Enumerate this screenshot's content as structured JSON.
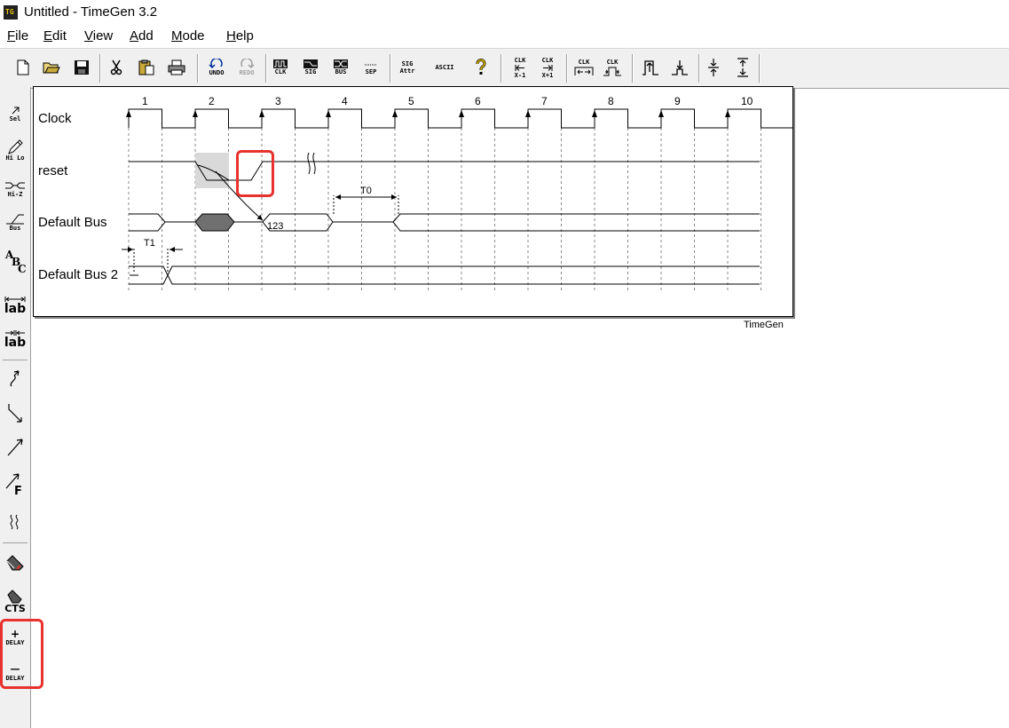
{
  "window": {
    "title": "Untitled - TimeGen 3.2",
    "icon": "timegen-app-icon",
    "icon_text": "TG"
  },
  "menu": [
    {
      "accel": "F",
      "rest": "ile"
    },
    {
      "accel": "E",
      "rest": "dit"
    },
    {
      "accel": "V",
      "rest": "iew"
    },
    {
      "accel": "A",
      "rest": "dd"
    },
    {
      "accel": "M",
      "rest": "ode"
    },
    {
      "accel": "H",
      "rest": "elp"
    }
  ],
  "toolbar": {
    "undo": "UNDO",
    "redo": "REDO",
    "clk": "CLK",
    "sig": "SIG",
    "bus": "BUS",
    "sep": "SEP",
    "sig_attr_1": "SIG",
    "sig_attr_2": "Attr",
    "ascii": "ASCII",
    "clk_left_top": "CLK",
    "clk_left_bot": "X-1",
    "clk_right_top": "CLK",
    "clk_right_bot": "X+1",
    "clk_expand": "CLK",
    "clk_shrink": "CLK"
  },
  "left_toolbar": {
    "sel": "Sel",
    "hilo": "Hi Lo",
    "hiz": "Hi-Z",
    "bus": "Bus",
    "lab1": "lab",
    "lab2": "lab",
    "cts": "CTS",
    "delay_plus_sign": "+",
    "delay_plus": "DELAY",
    "delay_minus_sign": "—",
    "delay_minus": "DELAY"
  },
  "diagram": {
    "clock_numbers": [
      "1",
      "2",
      "3",
      "4",
      "5",
      "6",
      "7",
      "8",
      "9",
      "10"
    ],
    "signals": [
      "Clock",
      "reset",
      "Default Bus",
      "Default Bus 2"
    ],
    "bus_value": "123",
    "delay_label_t0": "T0",
    "delay_label_t1": "T1",
    "watermark": "TimeGen"
  },
  "colors": {
    "highlight": "#e8322e",
    "shade": "#d9d9d9",
    "bus_fill": "#707070"
  }
}
